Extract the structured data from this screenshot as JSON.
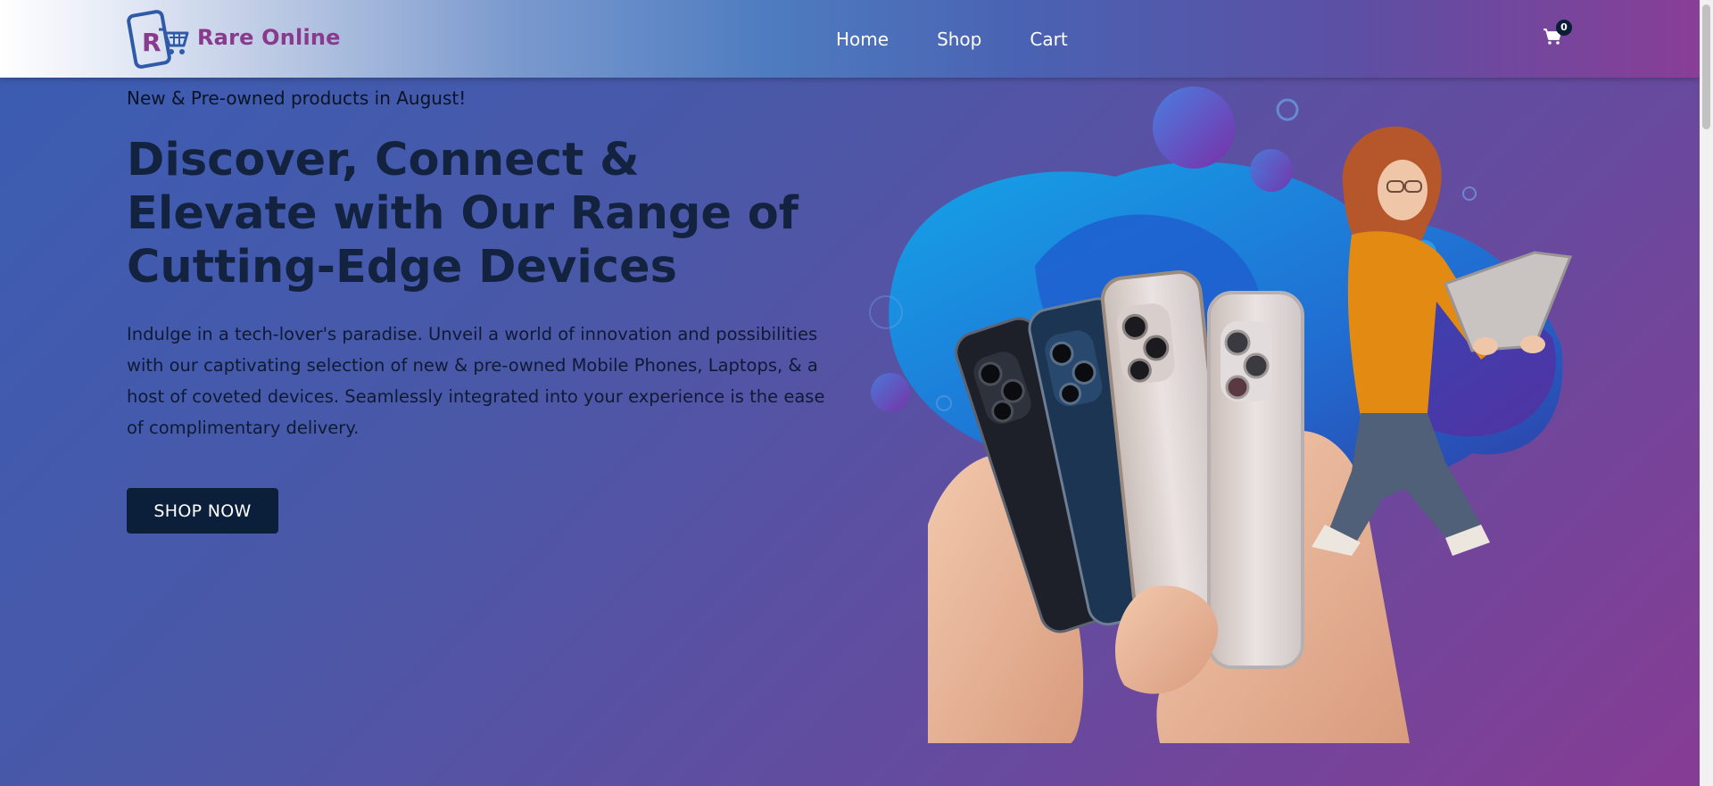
{
  "header": {
    "brand": "Rare Online",
    "logo_letter": "R",
    "nav": [
      {
        "label": "Home"
      },
      {
        "label": "Shop"
      },
      {
        "label": "Cart"
      }
    ],
    "cart_count": "0"
  },
  "hero": {
    "tagline": "New & Pre-owned products in August!",
    "headline": "Discover, Connect & Elevate with Our Range of Cutting-Edge Devices",
    "description": "Indulge in a tech-lover's paradise. Unveil a world of innovation and possibilities with our captivating selection of new & pre-owned Mobile Phones, Laptops, & a host of coveted devices. Seamlessly integrated into your experience is the ease of complimentary delivery.",
    "cta_label": "SHOP NOW"
  },
  "icons": {
    "logo": "phone-cart-logo-icon",
    "cart": "shopping-cart-icon"
  },
  "colors": {
    "brand": "#8a3a8c",
    "button_bg": "#0c1f3a",
    "headline": "#13233f",
    "nav_text": "#ffffff"
  }
}
